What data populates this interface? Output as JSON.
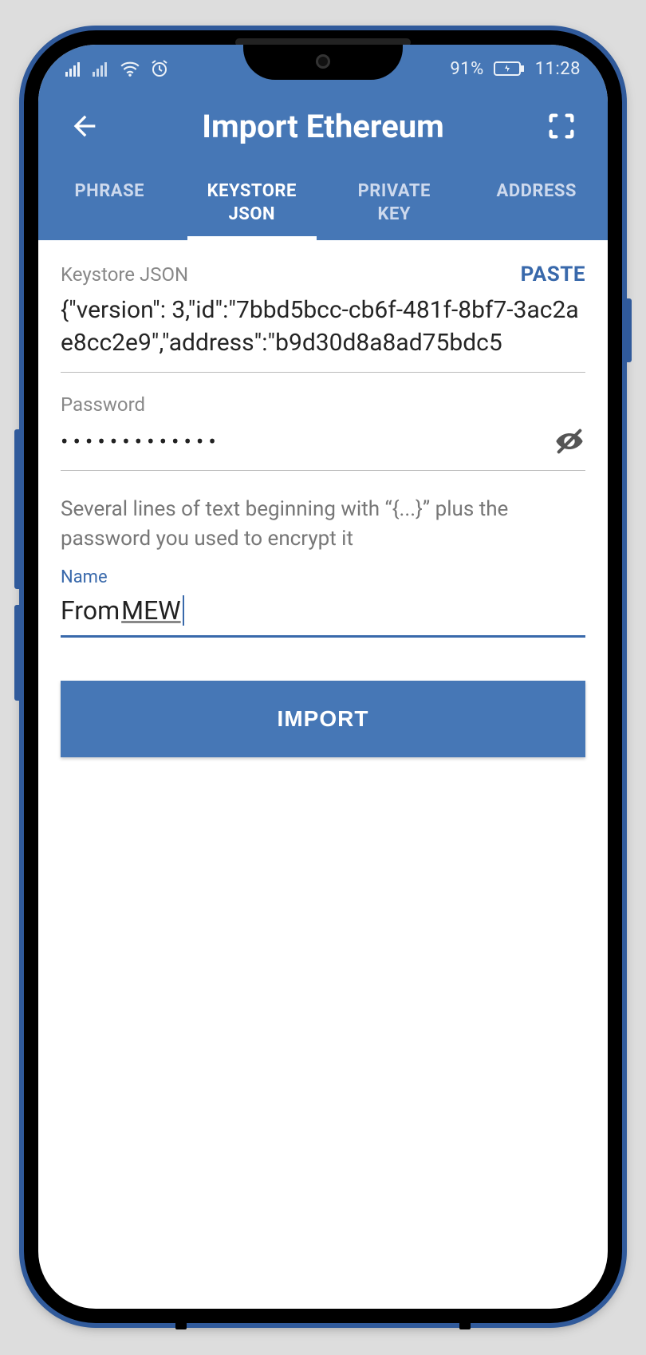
{
  "status": {
    "battery": "91%",
    "time": "11:28"
  },
  "appbar": {
    "title": "Import Ethereum"
  },
  "tabs": [
    {
      "label": "PHRASE"
    },
    {
      "label": "KEYSTORE JSON"
    },
    {
      "label": "PRIVATE KEY"
    },
    {
      "label": "ADDRESS"
    }
  ],
  "active_tab_index": 1,
  "fields": {
    "keystore": {
      "label": "Keystore JSON",
      "paste_label": "PASTE",
      "value": "{\"version\": 3,\"id\":\"7bbd5bcc-cb6f-481f-8bf7-3ac2ae8cc2e9\",\"address\":\"b9d30d8a8ad75bdc5"
    },
    "password": {
      "label": "Password",
      "mask": "•••••••••••••"
    },
    "hint": "Several lines of text beginning with “{...}” plus the password you used to encrypt it",
    "name": {
      "label": "Name",
      "value_prefix": "From ",
      "value_underlined": "MEW"
    }
  },
  "import_button": "IMPORT",
  "colors": {
    "primary": "#4677b6",
    "accent": "#3969ab"
  }
}
